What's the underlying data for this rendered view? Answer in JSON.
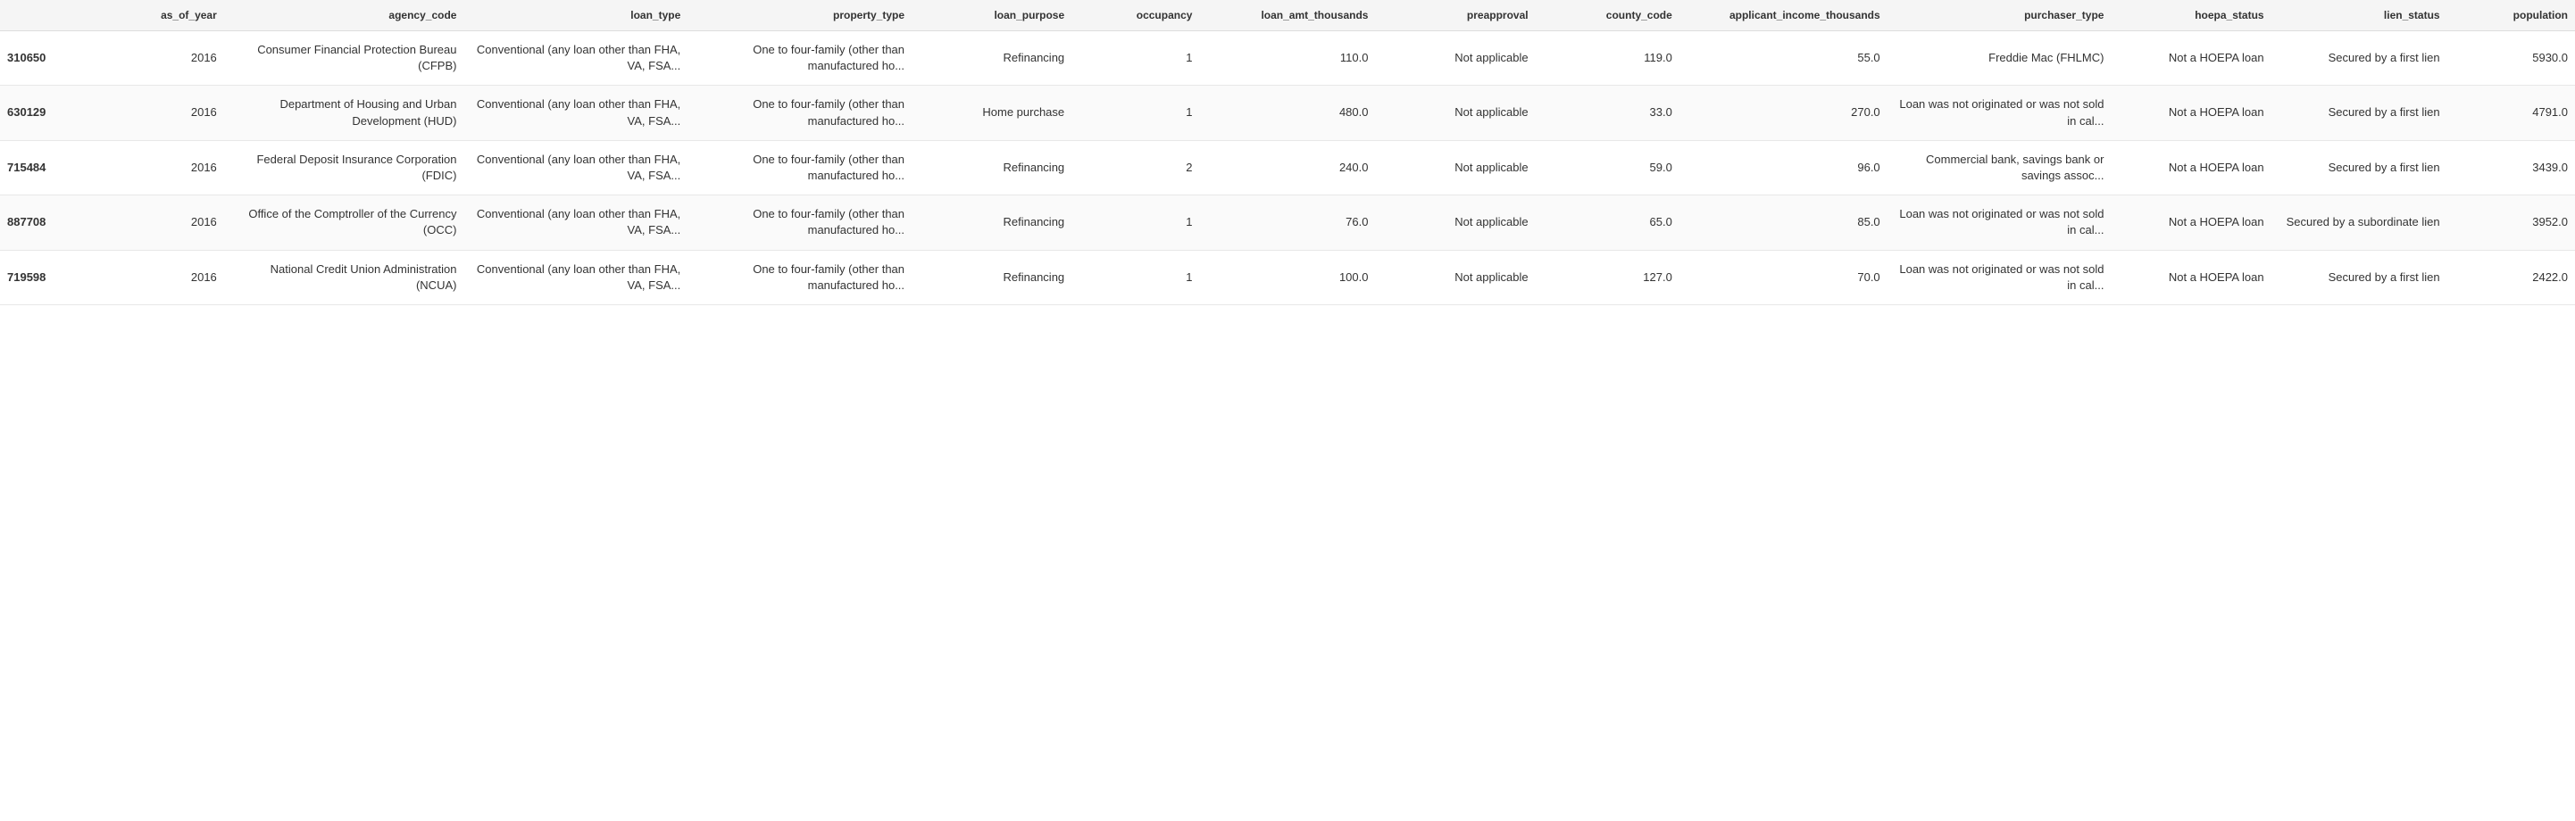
{
  "table": {
    "columns": [
      {
        "key": "index",
        "label": "",
        "class": "col-index"
      },
      {
        "key": "as_of_year",
        "label": "as_of_year",
        "class": "col-year"
      },
      {
        "key": "agency_code",
        "label": "agency_code",
        "class": "col-agency"
      },
      {
        "key": "loan_type",
        "label": "loan_type",
        "class": "col-loan-type"
      },
      {
        "key": "property_type",
        "label": "property_type",
        "class": "col-prop-type"
      },
      {
        "key": "loan_purpose",
        "label": "loan_purpose",
        "class": "col-purpose"
      },
      {
        "key": "occupancy",
        "label": "occupancy",
        "class": "col-occupancy"
      },
      {
        "key": "loan_amt_thousands",
        "label": "loan_amt_thousands",
        "class": "col-loan-amt"
      },
      {
        "key": "preapproval",
        "label": "preapproval",
        "class": "col-preapproval"
      },
      {
        "key": "county_code",
        "label": "county_code",
        "class": "col-county"
      },
      {
        "key": "applicant_income_thousands",
        "label": "applicant_income_thousands",
        "class": "col-income"
      },
      {
        "key": "purchaser_type",
        "label": "purchaser_type",
        "class": "col-purchaser"
      },
      {
        "key": "hoepa_status",
        "label": "hoepa_status",
        "class": "col-hoepa"
      },
      {
        "key": "lien_status",
        "label": "lien_status",
        "class": "col-lien"
      },
      {
        "key": "population",
        "label": "population",
        "class": "col-population"
      }
    ],
    "rows": [
      {
        "index": "310650",
        "as_of_year": "2016",
        "agency_code": "Consumer Financial Protection Bureau (CFPB)",
        "loan_type": "Conventional (any loan other than FHA, VA, FSA...",
        "property_type": "One to four-family (other than manufactured ho...",
        "loan_purpose": "Refinancing",
        "occupancy": "1",
        "loan_amt_thousands": "110.0",
        "preapproval": "Not applicable",
        "county_code": "119.0",
        "applicant_income_thousands": "55.0",
        "purchaser_type": "Freddie Mac (FHLMC)",
        "hoepa_status": "Not a HOEPA loan",
        "lien_status": "Secured by a first lien",
        "population": "5930.0"
      },
      {
        "index": "630129",
        "as_of_year": "2016",
        "agency_code": "Department of Housing and Urban Development (HUD)",
        "loan_type": "Conventional (any loan other than FHA, VA, FSA...",
        "property_type": "One to four-family (other than manufactured ho...",
        "loan_purpose": "Home purchase",
        "occupancy": "1",
        "loan_amt_thousands": "480.0",
        "preapproval": "Not applicable",
        "county_code": "33.0",
        "applicant_income_thousands": "270.0",
        "purchaser_type": "Loan was not originated or was not sold in cal...",
        "hoepa_status": "Not a HOEPA loan",
        "lien_status": "Secured by a first lien",
        "population": "4791.0"
      },
      {
        "index": "715484",
        "as_of_year": "2016",
        "agency_code": "Federal Deposit Insurance Corporation (FDIC)",
        "loan_type": "Conventional (any loan other than FHA, VA, FSA...",
        "property_type": "One to four-family (other than manufactured ho...",
        "loan_purpose": "Refinancing",
        "occupancy": "2",
        "loan_amt_thousands": "240.0",
        "preapproval": "Not applicable",
        "county_code": "59.0",
        "applicant_income_thousands": "96.0",
        "purchaser_type": "Commercial bank, savings bank or savings assoc...",
        "hoepa_status": "Not a HOEPA loan",
        "lien_status": "Secured by a first lien",
        "population": "3439.0"
      },
      {
        "index": "887708",
        "as_of_year": "2016",
        "agency_code": "Office of the Comptroller of the Currency (OCC)",
        "loan_type": "Conventional (any loan other than FHA, VA, FSA...",
        "property_type": "One to four-family (other than manufactured ho...",
        "loan_purpose": "Refinancing",
        "occupancy": "1",
        "loan_amt_thousands": "76.0",
        "preapproval": "Not applicable",
        "county_code": "65.0",
        "applicant_income_thousands": "85.0",
        "purchaser_type": "Loan was not originated or was not sold in cal...",
        "hoepa_status": "Not a HOEPA loan",
        "lien_status": "Secured by a subordinate lien",
        "population": "3952.0"
      },
      {
        "index": "719598",
        "as_of_year": "2016",
        "agency_code": "National Credit Union Administration (NCUA)",
        "loan_type": "Conventional (any loan other than FHA, VA, FSA...",
        "property_type": "One to four-family (other than manufactured ho...",
        "loan_purpose": "Refinancing",
        "occupancy": "1",
        "loan_amt_thousands": "100.0",
        "preapproval": "Not applicable",
        "county_code": "127.0",
        "applicant_income_thousands": "70.0",
        "purchaser_type": "Loan was not originated or was not sold in cal...",
        "hoepa_status": "Not a HOEPA loan",
        "lien_status": "Secured by a first lien",
        "population": "2422.0"
      }
    ]
  }
}
